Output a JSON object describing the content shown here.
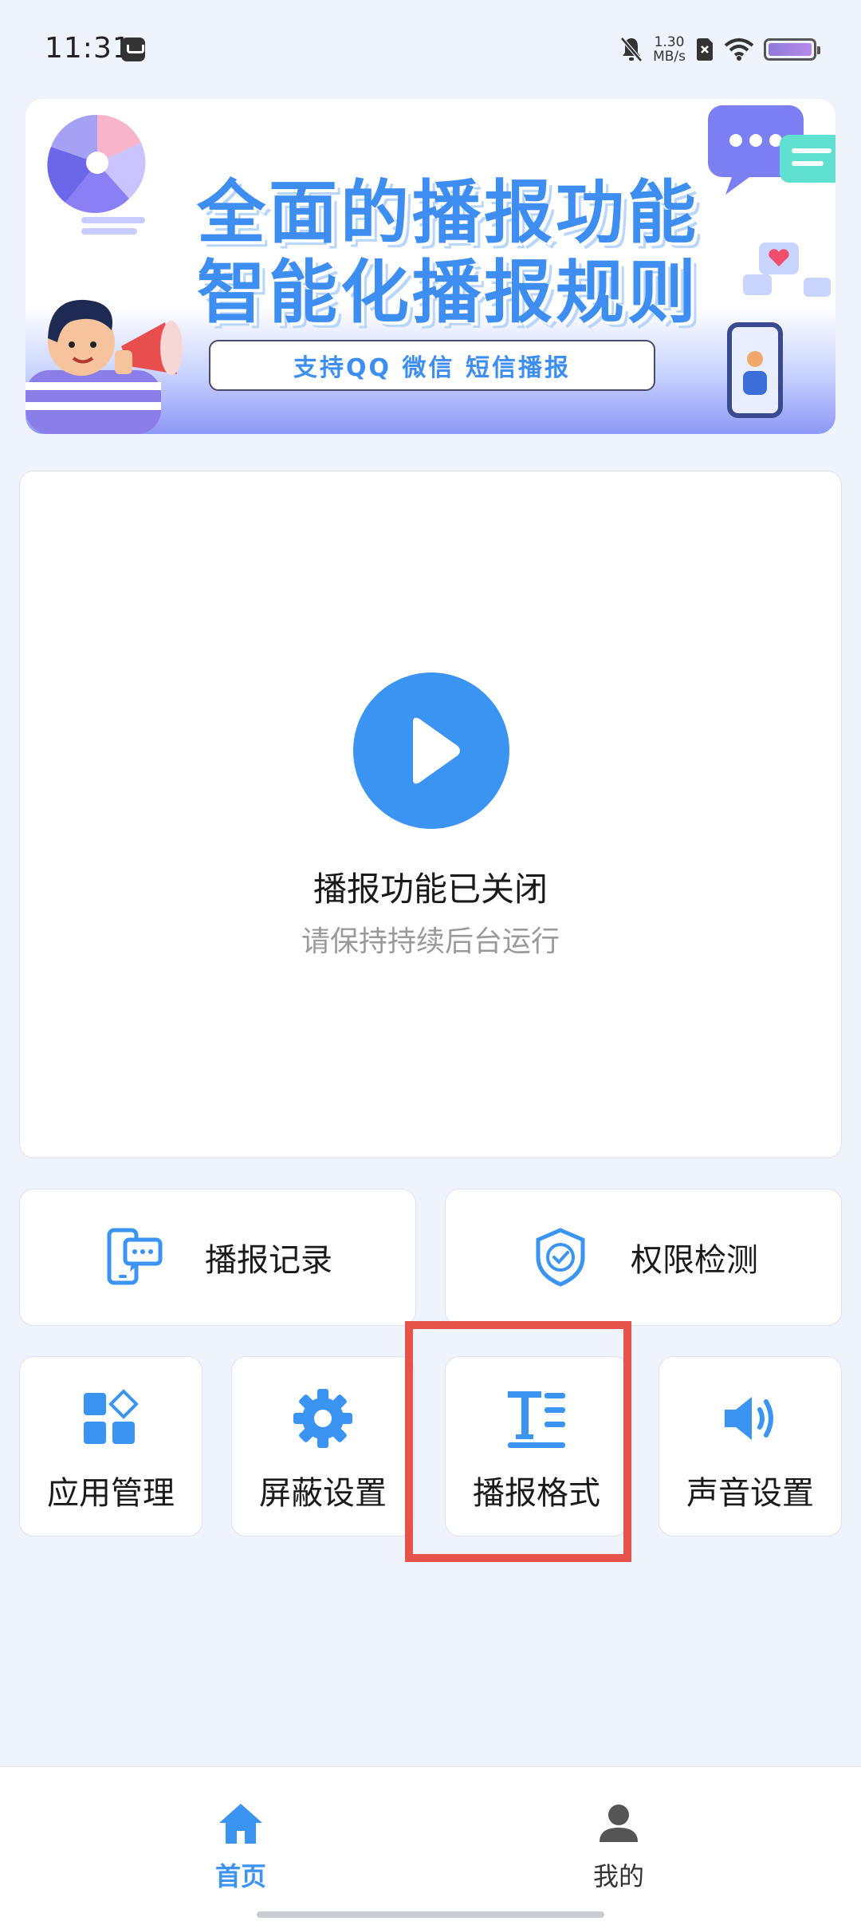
{
  "status_bar": {
    "time": "11:31",
    "net_speed_value": "1.30",
    "net_speed_unit": "MB/s"
  },
  "banner": {
    "line1": "全面的播报功能",
    "line2": "智能化播报规则",
    "pill": "支持QQ  微信  短信播报"
  },
  "main": {
    "title": "播报功能已关闭",
    "subtitle": "请保持持续后台运行"
  },
  "actions_wide": [
    {
      "label": "播报记录",
      "icon": "chat-phone-icon"
    },
    {
      "label": "权限检测",
      "icon": "shield-check-icon"
    }
  ],
  "actions_small": [
    {
      "label": "应用管理",
      "icon": "apps-grid-icon"
    },
    {
      "label": "屏蔽设置",
      "icon": "gear-icon"
    },
    {
      "label": "播报格式",
      "icon": "text-format-icon"
    },
    {
      "label": "声音设置",
      "icon": "speaker-icon"
    }
  ],
  "bottom_nav": {
    "home": "首页",
    "mine": "我的"
  },
  "colors": {
    "accent": "#3b93f2",
    "highlight": "#e5534b",
    "background": "#eef3fc"
  }
}
